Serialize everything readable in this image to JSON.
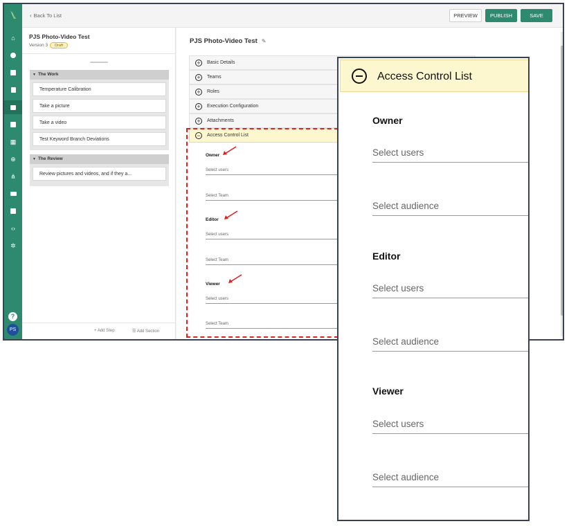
{
  "topbar": {
    "back_label": "Back To List",
    "preview_label": "PREVIEW",
    "publish_label": "PUBLISH",
    "save_label": "SAVE"
  },
  "rail": {
    "avatar_initials": "PS",
    "help_label": "?",
    "accent_color": "#2e8a6f"
  },
  "procedure": {
    "title": "PJS Photo-Video Test",
    "version": "Version 3",
    "status": "Draft"
  },
  "sections": [
    {
      "name": "The Work",
      "steps": [
        "Temperature Calibration",
        "Take a picture",
        "Take a video",
        "Test Keyword Branch Deviations"
      ]
    },
    {
      "name": "The Review",
      "steps": [
        "Review pictures and videos, and if they a..."
      ]
    }
  ],
  "left_footer": {
    "add_step": "Add Step",
    "add_section": "Add Section"
  },
  "main": {
    "title": "PJS Photo-Video Test",
    "accordions": [
      "Basic Details",
      "Teams",
      "Roles",
      "Execution Configuration",
      "Attachments",
      "Access Control List"
    ]
  },
  "acl": {
    "owner_label": "Owner",
    "editor_label": "Editor",
    "viewer_label": "Viewer",
    "select_users": "Select users",
    "select_team": "Select Team"
  },
  "zoom": {
    "header": "Access Control List",
    "owner_label": "Owner",
    "editor_label": "Editor",
    "viewer_label": "Viewer",
    "select_users": "Select users",
    "select_audience": "Select audience"
  }
}
